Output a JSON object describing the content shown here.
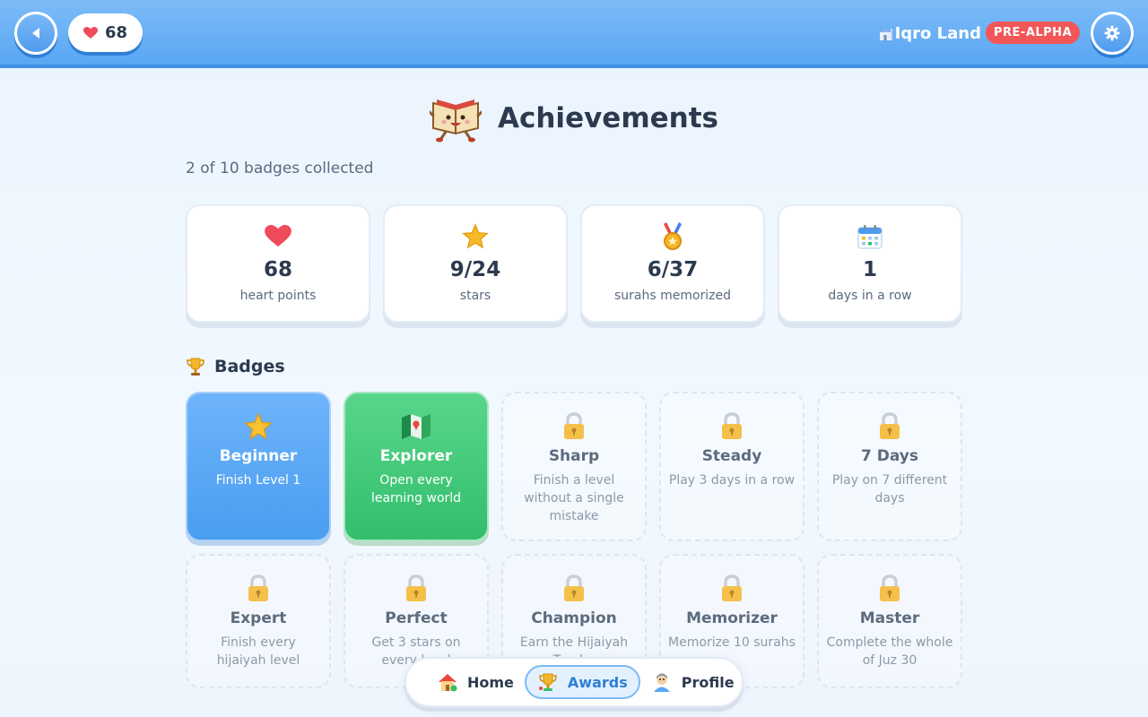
{
  "header": {
    "hearts_count": "68",
    "brand_title": "Iqro Land",
    "brand_badge": "PRE-ALPHA"
  },
  "page": {
    "title": "Achievements",
    "subtitle": "2 of 10 badges collected"
  },
  "stats": [
    {
      "value": "68",
      "label": "heart points",
      "icon": "heart-icon"
    },
    {
      "value": "9/24",
      "label": "stars",
      "icon": "star-icon"
    },
    {
      "value": "6/37",
      "label": "surahs memorized",
      "icon": "medal-icon"
    },
    {
      "value": "1",
      "label": "days in a row",
      "icon": "calendar-icon"
    }
  ],
  "badges_section": {
    "title": "Badges",
    "items": [
      {
        "name": "Beginner",
        "desc": "Finish Level 1",
        "state": "unlocked",
        "color": "#4a9df0",
        "icon": "star-icon"
      },
      {
        "name": "Explorer",
        "desc": "Open every learning world",
        "state": "unlocked",
        "color": "#33be6c",
        "icon": "map-icon"
      },
      {
        "name": "Sharp",
        "desc": "Finish a level without a single mistake",
        "state": "locked",
        "icon": "lock-icon"
      },
      {
        "name": "Steady",
        "desc": "Play 3 days in a row",
        "state": "locked",
        "icon": "lock-icon"
      },
      {
        "name": "7 Days",
        "desc": "Play on 7 different days",
        "state": "locked",
        "icon": "lock-icon"
      },
      {
        "name": "Expert",
        "desc": "Finish every hijaiyah level",
        "state": "locked",
        "icon": "lock-icon"
      },
      {
        "name": "Perfect",
        "desc": "Get 3 stars on every level",
        "state": "locked",
        "icon": "lock-icon"
      },
      {
        "name": "Champion",
        "desc": "Earn the Hijaiyah Trophy",
        "state": "locked",
        "icon": "lock-icon"
      },
      {
        "name": "Memorizer",
        "desc": "Memorize 10 surahs",
        "state": "locked",
        "icon": "lock-icon"
      },
      {
        "name": "Master",
        "desc": "Complete the whole of Juz 30",
        "state": "locked",
        "icon": "lock-icon"
      }
    ]
  },
  "nav": {
    "items": [
      {
        "label": "Home",
        "icon": "house-icon",
        "active": false
      },
      {
        "label": "Awards",
        "icon": "trophy-icon",
        "active": true
      },
      {
        "label": "Profile",
        "icon": "avatar-icon",
        "active": false
      }
    ]
  },
  "colors": {
    "header_bg": "#5aa7f3",
    "badge_pill": "#f25757",
    "heart": "#ef4b5a",
    "unlocked_blue": "#4a9df0",
    "unlocked_green": "#33be6c"
  }
}
